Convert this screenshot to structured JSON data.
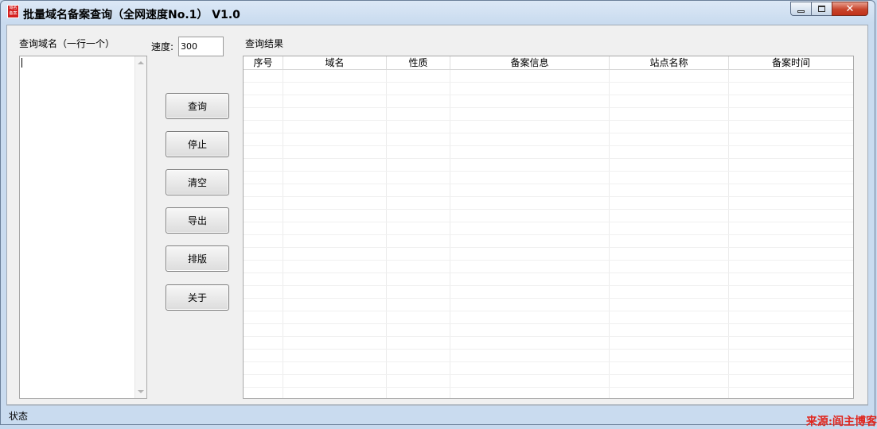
{
  "window": {
    "title": "批量域名备案查询（全网速度No.1） V1.0",
    "icon_text": [
      "域名",
      "备案"
    ],
    "controls": {
      "minimize": "minimize",
      "maximize": "maximize",
      "close": "✕"
    }
  },
  "left_panel": {
    "label": "查询域名（一行一个）",
    "value": ""
  },
  "speed": {
    "label": "速度:",
    "value": "300"
  },
  "buttons": {
    "query": "查询",
    "stop": "停止",
    "clear": "清空",
    "export": "导出",
    "format": "排版",
    "about": "关于"
  },
  "results": {
    "label": "查询结果",
    "columns": [
      "序号",
      "域名",
      "性质",
      "备案信息",
      "站点名称",
      "备案时间"
    ],
    "rows": []
  },
  "status": {
    "text": "状态"
  },
  "watermark": "来源:阎主博客",
  "colors": {
    "frame": "#c9dbef",
    "client": "#f0f0f0",
    "close_button": "#c8442b",
    "watermark": "#e0261e"
  }
}
